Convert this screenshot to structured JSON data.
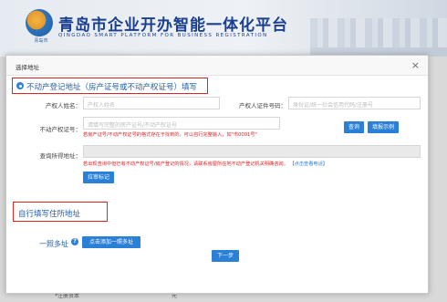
{
  "background": {
    "title": "青岛市企业开办智能一体化平台",
    "subtitle": "QINGDAO SMART PLATFORM FOR BUSINESS REGISTRATION",
    "logo_text": "青岛市",
    "bottom_left": "*注册资本",
    "bottom_right": "元"
  },
  "modal": {
    "title": "选择地址",
    "close": "×",
    "section1": {
      "label": "不动产登记地址（房产证号或不动产权证号）填写",
      "owner_name_label": "产权人姓名：",
      "owner_name_placeholder": "产权人姓名",
      "owner_id_label": "产权人证件号码：",
      "owner_id_placeholder": "身份证/统一社会信用代码/注册号",
      "cert_no_label": "不动产权证号：",
      "cert_no_placeholder": "请填写完整的房产证号/不动产权证号",
      "query_button": "查询",
      "example_button": "填报示例",
      "cert_hint": "若房产证号/不动产权证号的格式存在于找到的，可以自行完整输入，如\"市0001号\"",
      "address_label": "查询所得地址：",
      "address_hint": "若出现查询中但已有不动产权证号/房产登记的情况，请联系房屋所在地不动产登记机关明确咨询。",
      "address_hint_link": "【点击查看电话】",
      "mark_button": "拉审标记"
    },
    "section2": {
      "label": "自行填写住所地址"
    },
    "multi_address_label": "一照多址",
    "help_icon": "?",
    "add_multi_button": "点击添加一照多址",
    "next_button": "下一步"
  }
}
